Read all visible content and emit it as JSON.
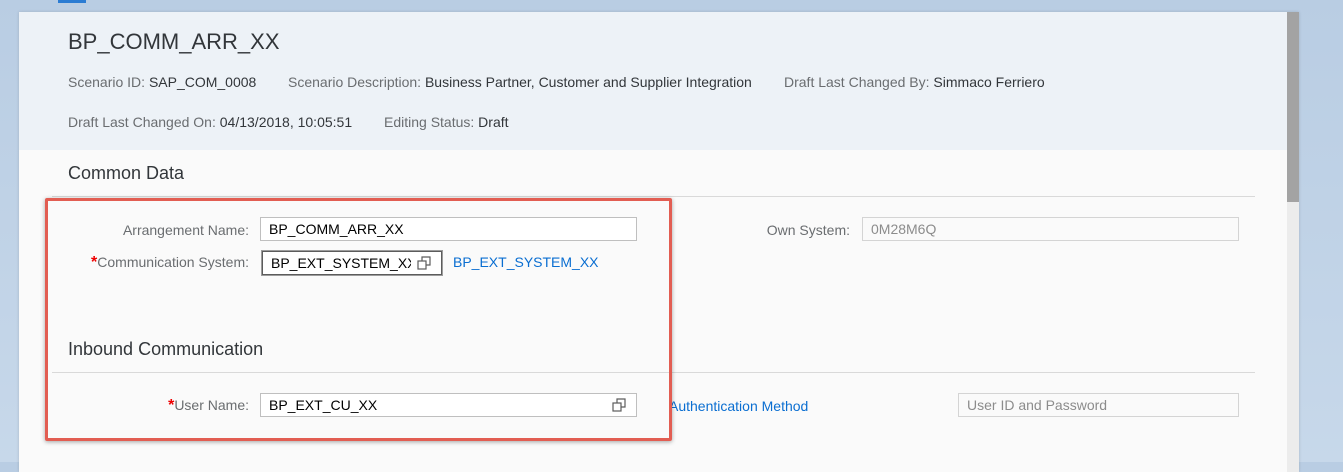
{
  "page": {
    "title": "BP_COMM_ARR_XX"
  },
  "header": {
    "scenario_id": {
      "label": "Scenario ID:",
      "value": "SAP_COM_0008"
    },
    "scenario_description": {
      "label": "Scenario Description:",
      "value": "Business Partner, Customer and Supplier Integration"
    },
    "draft_changed_by": {
      "label": "Draft Last Changed By:",
      "value": "Simmaco Ferriero"
    },
    "draft_changed_on": {
      "label": "Draft Last Changed On:",
      "value": "04/13/2018, 10:05:51"
    },
    "editing_status": {
      "label": "Editing Status:",
      "value": "Draft"
    }
  },
  "common_data": {
    "section_title": "Common Data",
    "arrangement_name": {
      "label": "Arrangement Name:",
      "value": "BP_COMM_ARR_XX"
    },
    "communication_system": {
      "required_marker": "*",
      "label": "Communication System:",
      "value": "BP_EXT_SYSTEM_XX",
      "link": "BP_EXT_SYSTEM_XX"
    },
    "own_system": {
      "label": "Own System:",
      "value": "0M28M6Q"
    }
  },
  "inbound": {
    "section_title": "Inbound Communication",
    "user_name": {
      "required_marker": "*",
      "label": "User Name:",
      "value": "BP_EXT_CU_XX"
    },
    "authentication_method": {
      "link": "Authentication Method",
      "value": "User ID and Password"
    }
  },
  "icons": {
    "value_help": "value-help-icon"
  },
  "colors": {
    "header_bg": "#edf2f7",
    "link": "#0a6ed1",
    "required": "#e00000",
    "highlight_border": "#e25d52",
    "page_bg": "#c7d8ea"
  }
}
